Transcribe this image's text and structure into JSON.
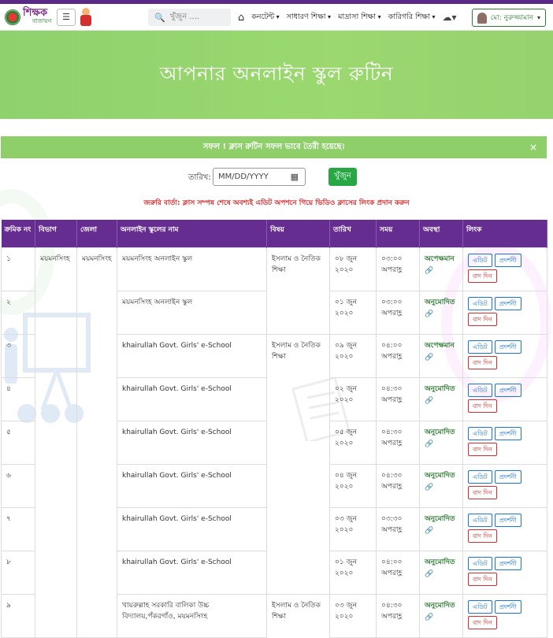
{
  "header": {
    "logo_main": "শিক্ষক",
    "logo_sub": "বাতায়ন",
    "search_placeholder": "খুঁজুন ....",
    "nav": [
      "কনটেন্ট",
      "সাধারণ শিক্ষা",
      "মাদ্রাসা শিক্ষা",
      "কারিগরি শিক্ষা"
    ],
    "user_name": "মো: নুরুজ্জামান"
  },
  "hero_title": "আপনার অনলাইন স্কুল রুটিন",
  "alert": {
    "message": "সফল ! ক্লাস রুটিন সফল ভাবে তৈরী হয়েছে।",
    "close": "×"
  },
  "date_filter": {
    "label": "তারিখ:",
    "placeholder": "MM/DD/YYYY",
    "button": "খুঁজুন"
  },
  "notice": "জরুরি বার্তা: ক্লাস সম্পন্ন শেষে অবশ্যই এডিট অপশনে গিয়ে ভিডিও ক্লাসের লিংক প্রদান করুন",
  "table": {
    "headers": [
      "ক্রমিক নং",
      "বিভাগ",
      "জেলা",
      "অনলাইন স্কুলের নাম",
      "বিষয়",
      "তারিখ",
      "সময়",
      "অবস্থা",
      "লিংক"
    ],
    "division": "ময়মনসিংহ",
    "district": "ময়মনসিংহ",
    "actions": {
      "edit": "এডিট",
      "show": "প্রদর্শনী",
      "cancel": "বাদ দিন"
    },
    "rows": [
      {
        "sl": "১",
        "school": "ময়মনসিংহ অনলাইন স্কুল",
        "subject": "ইসলাম ও নৈতিক শিক্ষা",
        "date": "০৮ জুন ২০২০",
        "time": "০৩:০০ অপরাহ্ণ",
        "status": "অপেক্ষমান"
      },
      {
        "sl": "২",
        "school": "ময়মনসিংহ অনলাইন স্কুল",
        "subject": "",
        "date": "০১ জুন ২০২০",
        "time": "০৩:০০ অপরাহ্ণ",
        "status": "অনুমোদিত"
      },
      {
        "sl": "৩",
        "school": "khairullah Govt. Girls' e-School",
        "subject": "ইসলাম ও নৈতিক শিক্ষা",
        "date": "০৯ জুন ২০২০",
        "time": "০৪:০০ অপরাহ্ণ",
        "status": "অপেক্ষমান"
      },
      {
        "sl": "৪",
        "school": "khairullah Govt. Girls' e-School",
        "subject": "",
        "date": "০২ জুন ২০২০",
        "time": "০৪:৩০ অপরাহ্ণ",
        "status": "অনুমোদিত"
      },
      {
        "sl": "৫",
        "school": "khairullah Govt. Girls' e-School",
        "subject": "",
        "date": "০৫ জুন ২০২০",
        "time": "০৪:৩০ অপরাহ্ণ",
        "status": "অনুমোদিত"
      },
      {
        "sl": "৬",
        "school": "khairullah Govt. Girls' e-School",
        "subject": "",
        "date": "০৪ জুন ২০২০",
        "time": "০৪:৩০ অপরাহ্ণ",
        "status": "অনুমোদিত"
      },
      {
        "sl": "৭",
        "school": "khairullah Govt. Girls' e-School",
        "subject": "",
        "date": "০৩ জুন ২০২০",
        "time": "০৩:৩০ অপরাহ্ণ",
        "status": "অনুমোদিত"
      },
      {
        "sl": "৮",
        "school": "khairullah Govt. Girls' e-School",
        "subject": "",
        "date": "০১ জুন ২০২০",
        "time": "০৪:০০ অপরাহ্ণ",
        "status": "অনুমোদিত"
      },
      {
        "sl": "৯",
        "school": "খায়রুল্লাহ সরকারি বালিকা উচ্চ বিদ্যালয়,পঁকরগাঁও, ময়মনসিংহ",
        "subject": "ইসলাম ও নৈতিক শিক্ষা",
        "date": "০৩ জুন ২০২০",
        "time": "০৪:৩০ অপরাহ্ণ",
        "status": "অনুমোদিত"
      }
    ]
  },
  "colors": {
    "purple": "#662d91",
    "green": "#28a745",
    "hero_green": "#8fd16d",
    "alert_green": "#8fcf6a",
    "notice_red": "#d32f2f"
  }
}
